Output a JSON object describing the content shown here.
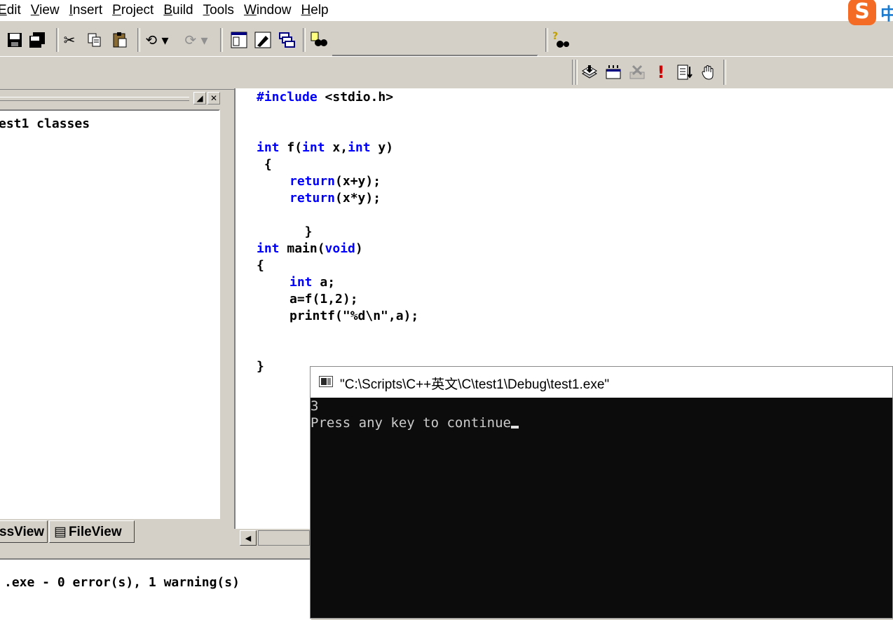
{
  "menu": {
    "items": [
      {
        "name": "edit",
        "label_u": "E",
        "label_rest": "dit"
      },
      {
        "name": "view",
        "label_u": "V",
        "label_rest": "iew"
      },
      {
        "name": "insert",
        "label_u": "I",
        "label_rest": "nsert"
      },
      {
        "name": "project",
        "label_u": "P",
        "label_rest": "roject"
      },
      {
        "name": "build",
        "label_u": "B",
        "label_rest": "uild"
      },
      {
        "name": "tools",
        "label_u": "T",
        "label_rest": "ools"
      },
      {
        "name": "window",
        "label_u": "W",
        "label_rest": "indow"
      },
      {
        "name": "help",
        "label_u": "H",
        "label_rest": "elp"
      }
    ],
    "ime_logo": "S",
    "ime_text": "中"
  },
  "workspace": {
    "tree_label": "est1 classes",
    "tabs": {
      "classview": "ssView",
      "fileview": "FileView"
    }
  },
  "editor": {
    "lines": [
      {
        "kw": "#include",
        "rest": " <stdio.h>"
      },
      {
        "kw": "int",
        "rest": " f(",
        "kw2": "int",
        "rest2": " x,",
        "kw3": "int",
        "rest3": " y)"
      },
      {
        "text": " {"
      },
      {
        "kw": "return",
        "rest": "(x+y);"
      },
      {
        "kw": "return",
        "rest": "(x*y);"
      },
      {
        "text": "  }"
      },
      {
        "kw": "int",
        "rest": " main(",
        "kw2": "void",
        "rest2": ")"
      },
      {
        "text": "{"
      },
      {
        "kw": "int",
        "rest": " a;"
      },
      {
        "text": "a=f(1,2);"
      },
      {
        "text": "printf(\"%d\\n\",a);"
      },
      {
        "text": "}"
      }
    ]
  },
  "output": {
    "line": ".exe - 0 error(s), 1 warning(s)"
  },
  "console": {
    "title": "\"C:\\Scripts\\C++英文\\C\\test1\\Debug\\test1.exe\"",
    "lines": [
      "3",
      "Press any key to continue"
    ]
  }
}
